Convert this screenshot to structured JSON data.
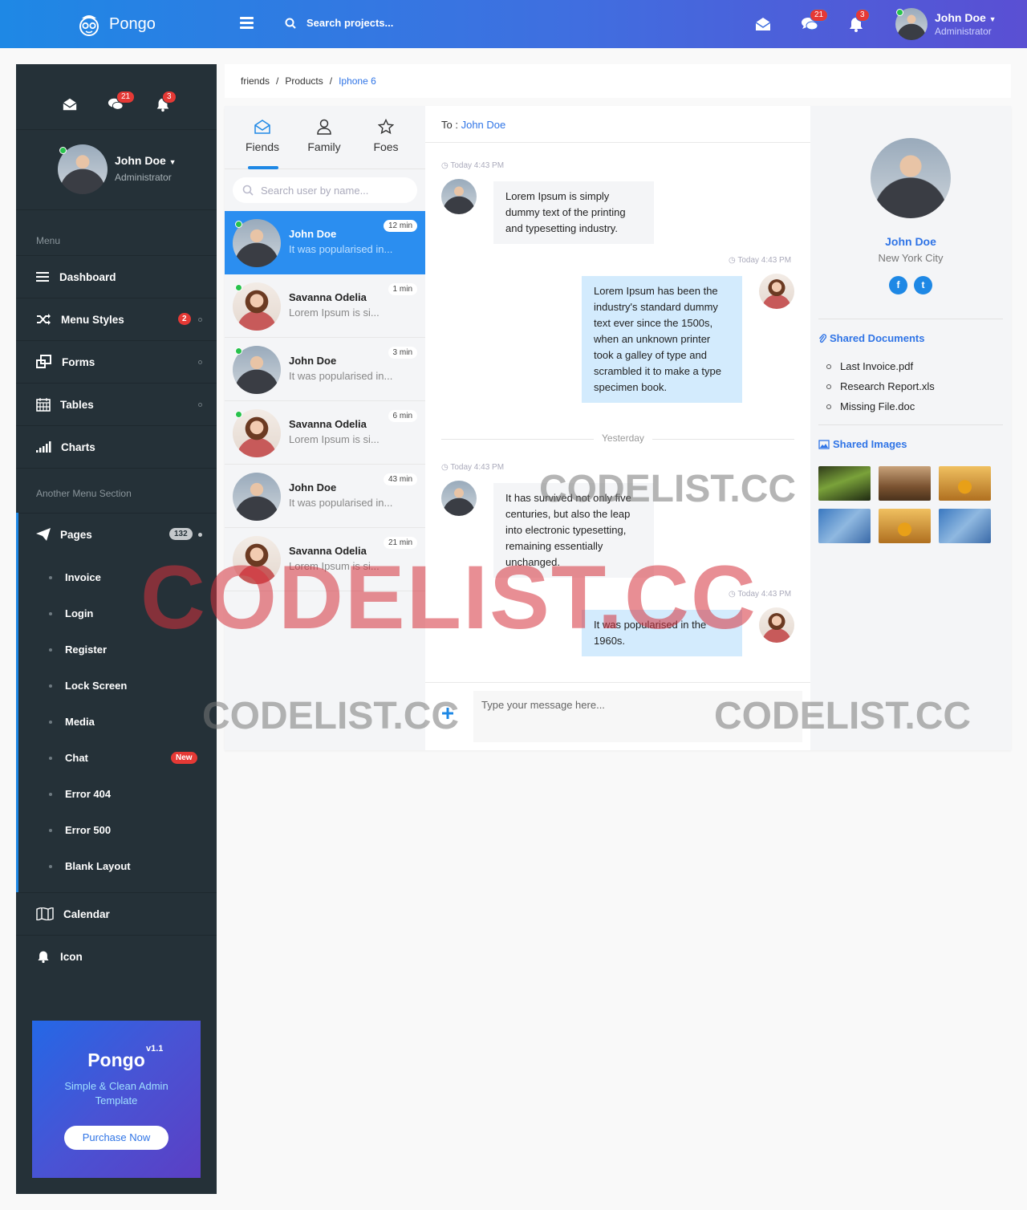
{
  "topbar": {
    "brand": "Pongo",
    "search_placeholder": "Search projects...",
    "messages_badge": "21",
    "notifications_badge": "3",
    "user_name": "John Doe",
    "user_role": "Administrator"
  },
  "sidebar": {
    "messages_badge": "21",
    "notifications_badge": "3",
    "user_name": "John Doe",
    "user_role": "Administrator",
    "menu_title": "Menu",
    "items": [
      {
        "label": "Dashboard",
        "icon": "bars-icon"
      },
      {
        "label": "Menu Styles",
        "icon": "shuffle-icon",
        "badge": "2"
      },
      {
        "label": "Forms",
        "icon": "clone-icon"
      },
      {
        "label": "Tables",
        "icon": "calendar-grid-icon"
      },
      {
        "label": "Charts",
        "icon": "signal-icon"
      }
    ],
    "section2_title": "Another Menu Section",
    "pages": {
      "label": "Pages",
      "badge": "132",
      "children": [
        "Invoice",
        "Login",
        "Register",
        "Lock Screen",
        "Media",
        "Chat",
        "Error 404",
        "Error 500",
        "Blank Layout"
      ],
      "chat_badge": "New"
    },
    "items2": [
      {
        "label": "Calendar",
        "icon": "map-icon"
      },
      {
        "label": "Icon",
        "icon": "bell-icon"
      }
    ],
    "promo": {
      "title": "Pongo",
      "version": "v1.1",
      "subtitle": "Simple & Clean Admin Template",
      "button": "Purchase Now"
    }
  },
  "breadcrumb": [
    "friends",
    "Products",
    "Iphone 6"
  ],
  "contacts": {
    "tabs": [
      "Fiends",
      "Family",
      "Foes"
    ],
    "search_placeholder": "Search user by name...",
    "list": [
      {
        "name": "John Doe",
        "preview": "It was popularised in...",
        "time": "12 min",
        "gender": "m",
        "online": true
      },
      {
        "name": "Savanna Odelia",
        "preview": "Lorem Ipsum is si...",
        "time": "1 min",
        "gender": "f",
        "online": true
      },
      {
        "name": "John Doe",
        "preview": "It was popularised in...",
        "time": "3 min",
        "gender": "m",
        "online": true
      },
      {
        "name": "Savanna Odelia",
        "preview": "Lorem Ipsum is si...",
        "time": "6 min",
        "gender": "f",
        "online": true
      },
      {
        "name": "John Doe",
        "preview": "It was popularised in...",
        "time": "43 min",
        "gender": "m",
        "online": false
      },
      {
        "name": "Savanna Odelia",
        "preview": "Lorem Ipsum is si...",
        "time": "21 min",
        "gender": "f",
        "online": false
      }
    ]
  },
  "conversation": {
    "to_label": "To :",
    "to_name": "John Doe",
    "messages": [
      {
        "time": "Today 4:43 PM",
        "text": "Lorem Ipsum is simply dummy text of the printing and typesetting industry.",
        "dir": "in"
      },
      {
        "time": "Today 4:43 PM",
        "text": "Lorem Ipsum has been the industry's standard dummy text ever since the 1500s, when an unknown printer took a galley of type and scrambled it to make a type specimen book.",
        "dir": "out"
      },
      {
        "time": "Today 4:43 PM",
        "text": "It has survived not only five centuries, but also the leap into electronic typesetting, remaining essentially unchanged.",
        "dir": "in"
      },
      {
        "time": "Today 4:43 PM",
        "text": "It was popularised in the 1960s.",
        "dir": "out"
      }
    ],
    "divider": "Yesterday",
    "composer_placeholder": "Type your message here..."
  },
  "profile": {
    "name": "John Doe",
    "location": "New York City",
    "shared_documents_title": "Shared Documents",
    "documents": [
      "Last Invoice.pdf",
      "Research Report.xls",
      "Missing File.doc"
    ],
    "shared_images_title": "Shared Images"
  },
  "watermark": "CODELIST.CC",
  "colors": {
    "accent": "#1e88e5",
    "sidebar": "#253138",
    "badge": "#e53935",
    "online": "#27c24c"
  }
}
